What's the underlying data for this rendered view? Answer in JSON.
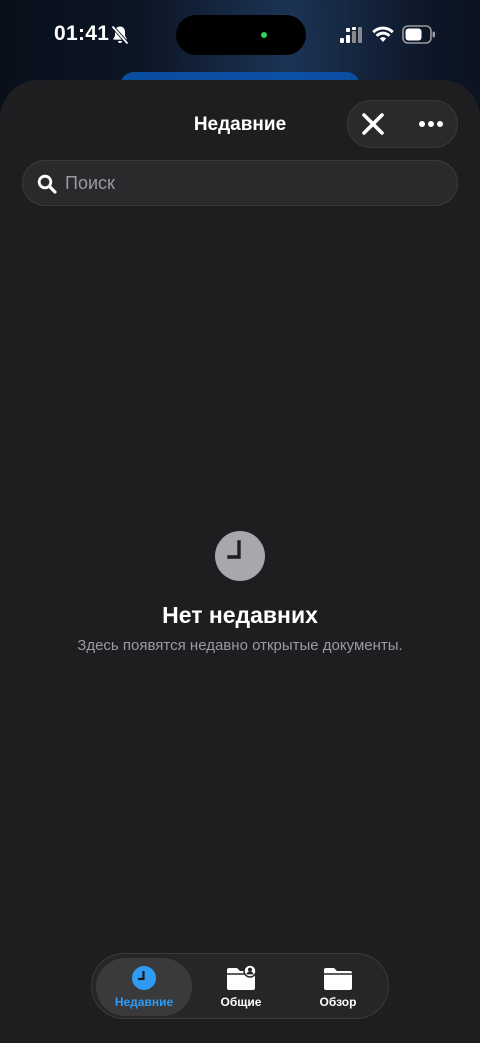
{
  "status_bar": {
    "time": "01:41",
    "icons": [
      "bell-slash-icon",
      "cellular-signal-icon",
      "wifi-icon",
      "battery-icon"
    ]
  },
  "sheet": {
    "title": "Недавние",
    "close_icon": "close-icon",
    "more_icon": "ellipsis-icon"
  },
  "search": {
    "placeholder": "Поиск",
    "value": ""
  },
  "empty_state": {
    "icon": "clock-icon",
    "title": "Нет недавних",
    "subtitle": "Здесь появятся недавно открытые документы."
  },
  "tabs": [
    {
      "label": "Недавние",
      "icon": "clock-icon",
      "active": true
    },
    {
      "label": "Общие",
      "icon": "shared-folder-icon",
      "active": false
    },
    {
      "label": "Обзор",
      "icon": "folder-icon",
      "active": false
    }
  ],
  "colors": {
    "accent": "#2f9bf5",
    "sheet_background": "#1e1e20",
    "secondary_text": "#9a9a9f"
  }
}
